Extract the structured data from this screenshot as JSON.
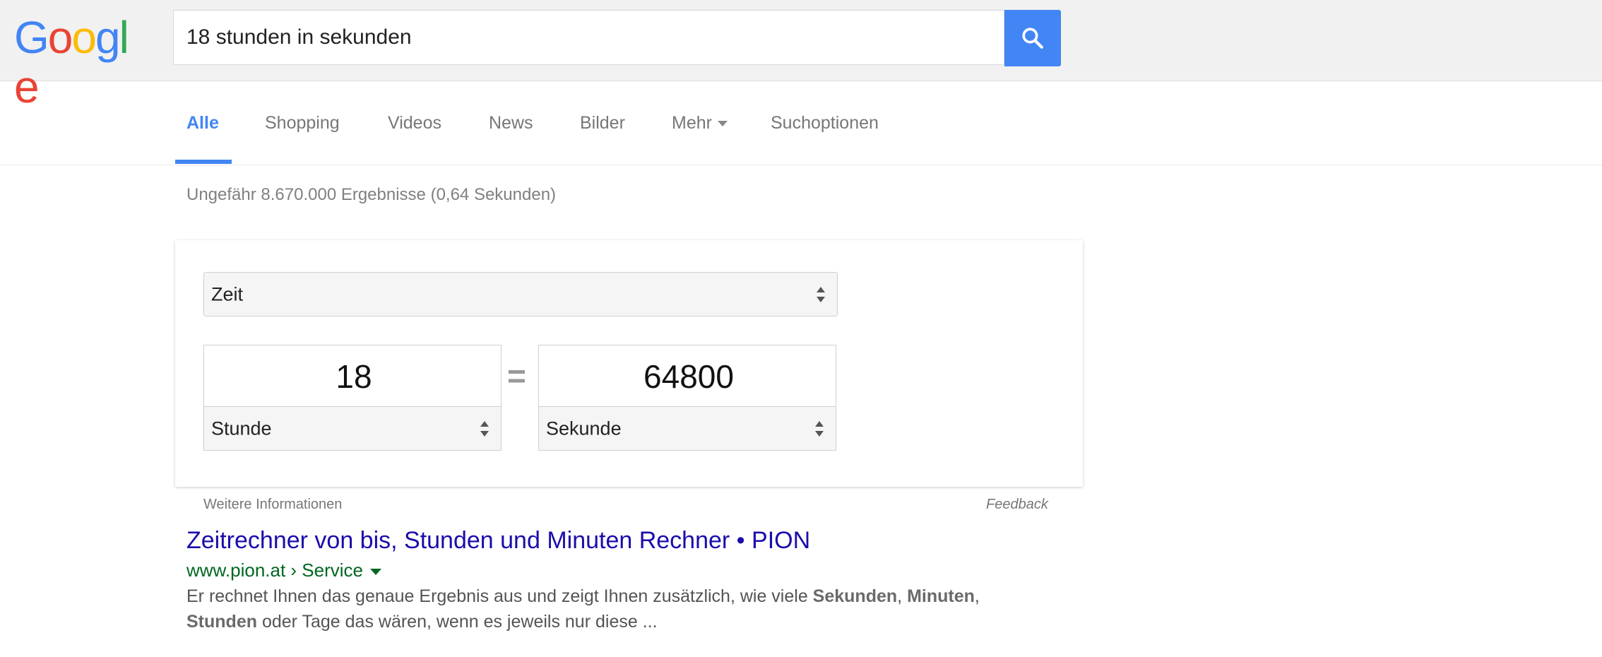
{
  "header": {
    "logo_letters": [
      {
        "char": "G",
        "color": "#4285f4"
      },
      {
        "char": "o",
        "color": "#ea4335"
      },
      {
        "char": "o",
        "color": "#fbbc05"
      },
      {
        "char": "g",
        "color": "#4285f4"
      },
      {
        "char": "l",
        "color": "#34a853"
      },
      {
        "char": "e",
        "color": "#ea4335"
      }
    ],
    "search_value": "18 stunden in sekunden",
    "search_button_icon": "search-icon"
  },
  "nav": {
    "items": [
      {
        "label": "Alle",
        "active": true
      },
      {
        "label": "Shopping"
      },
      {
        "label": "Videos"
      },
      {
        "label": "News"
      },
      {
        "label": "Bilder"
      },
      {
        "label": "Mehr"
      },
      {
        "label": "Suchoptionen"
      }
    ]
  },
  "results_stats": "Ungefähr 8.670.000 Ergebnisse (0,64 Sekunden)",
  "converter": {
    "category": "Zeit",
    "from_value": "18",
    "from_unit": "Stunde",
    "equals": "=",
    "to_value": "64800",
    "to_unit": "Sekunde",
    "more_info": "Weitere Informationen",
    "feedback": "Feedback"
  },
  "result": {
    "title": "Zeitrechner von bis, Stunden und Minuten Rechner • PION",
    "url": "www.pion.at › Service",
    "snippet_1": "Er rechnet Ihnen das genaue Ergebnis aus und zeigt Ihnen zusätzlich, wie viele ",
    "snippet_b1": "Sekunden",
    "snippet_2": ", ",
    "snippet_b2": "Minuten",
    "snippet_3": ",",
    "snippet_b3": "Stunden",
    "snippet_4": " oder Tage das wären, wenn es jeweils nur diese ..."
  },
  "colors": {
    "accent": "#4285f4",
    "link": "#1a0dab",
    "url_green": "#006621"
  }
}
